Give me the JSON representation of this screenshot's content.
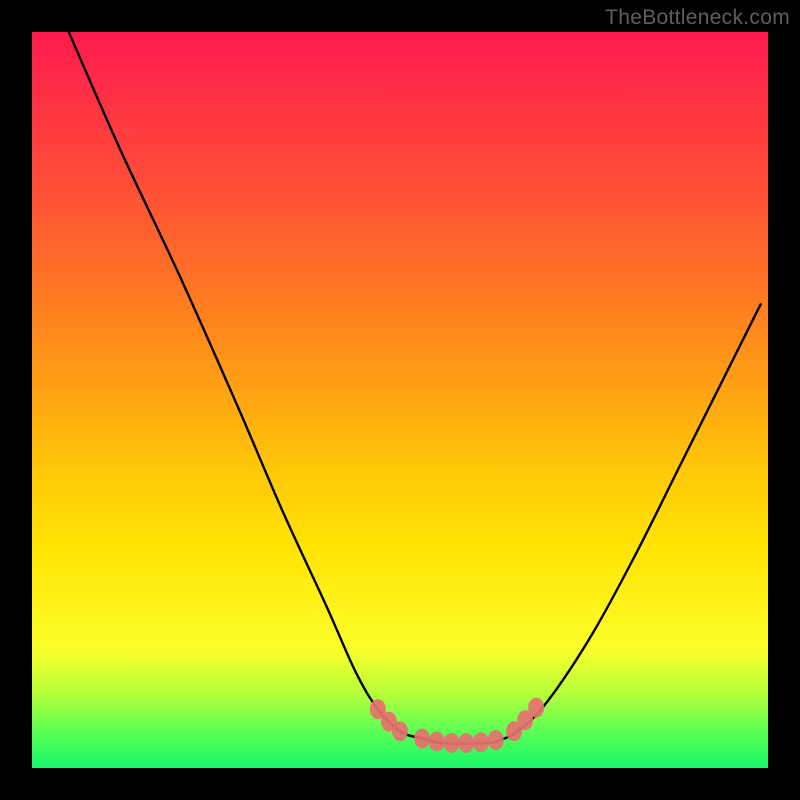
{
  "watermark": "TheBottleneck.com",
  "chart_data": {
    "type": "line",
    "title": "",
    "xlabel": "",
    "ylabel": "",
    "xlim": [
      0,
      100
    ],
    "ylim": [
      0,
      100
    ],
    "grid": false,
    "legend": false,
    "series": [
      {
        "name": "left-curve",
        "stroke": "#000000",
        "x": [
          5,
          12,
          20,
          28,
          34,
          40,
          44,
          47,
          50,
          53,
          55
        ],
        "y": [
          100,
          84,
          67,
          49,
          35,
          22,
          13,
          8,
          5,
          4,
          3.5
        ]
      },
      {
        "name": "valley-flat",
        "stroke": "#000000",
        "x": [
          55,
          57,
          60,
          62,
          63
        ],
        "y": [
          3.5,
          3.3,
          3.3,
          3.4,
          3.6
        ]
      },
      {
        "name": "right-curve",
        "stroke": "#000000",
        "x": [
          63,
          66,
          70,
          76,
          82,
          88,
          94,
          99
        ],
        "y": [
          3.6,
          5,
          9,
          18,
          29,
          41,
          53,
          63
        ]
      }
    ],
    "markers": {
      "name": "valley-dots",
      "fill": "#e77070",
      "points": [
        {
          "x": 47.0,
          "y": 8.0
        },
        {
          "x": 48.5,
          "y": 6.3
        },
        {
          "x": 50.0,
          "y": 5.0
        },
        {
          "x": 53.0,
          "y": 4.0
        },
        {
          "x": 55.0,
          "y": 3.6
        },
        {
          "x": 57.0,
          "y": 3.4
        },
        {
          "x": 59.0,
          "y": 3.4
        },
        {
          "x": 61.0,
          "y": 3.5
        },
        {
          "x": 63.0,
          "y": 3.8
        },
        {
          "x": 65.5,
          "y": 5.0
        },
        {
          "x": 67.0,
          "y": 6.5
        },
        {
          "x": 68.5,
          "y": 8.2
        }
      ]
    },
    "gradient_stops": [
      {
        "pos": 0.0,
        "color": "#ff1a4d"
      },
      {
        "pos": 0.5,
        "color": "#ffc000"
      },
      {
        "pos": 0.8,
        "color": "#fff31a"
      },
      {
        "pos": 1.0,
        "color": "#17f76a"
      }
    ]
  }
}
